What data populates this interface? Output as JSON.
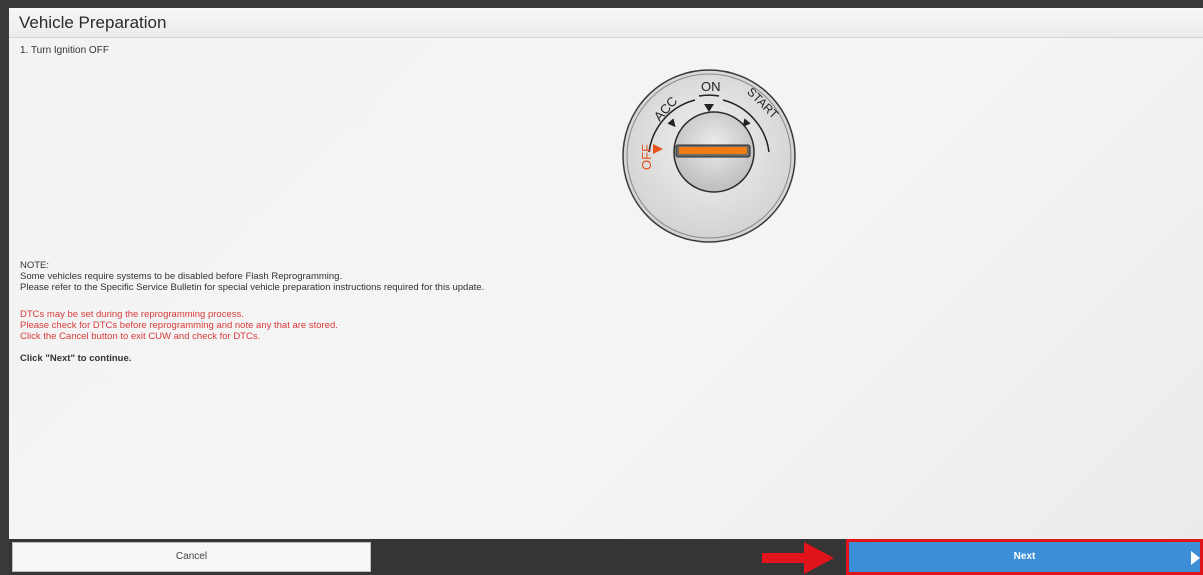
{
  "header": {
    "title": "Vehicle Preparation"
  },
  "step": "1. Turn Ignition OFF",
  "ignition": {
    "labels": {
      "off": "OFF",
      "acc": "ACC",
      "on": "ON",
      "start": "START"
    },
    "colors": {
      "off": "#e8531c",
      "slot": "#f07c12",
      "label": "#222222"
    }
  },
  "notes": {
    "heading": "NOTE:",
    "lines": [
      "Some vehicles require systems to be disabled before Flash Reprogramming.",
      "Please refer to the Specific Service Bulletin for special vehicle preparation instructions required for this update."
    ],
    "warnings": [
      "DTCs may be set during the reprogramming process.",
      "Please check for DTCs before reprogramming and note any that are stored.",
      "Click the Cancel button to exit CUW and check for DTCs."
    ],
    "continue": "Click \"Next\" to continue."
  },
  "footer": {
    "cancel_label": "Cancel",
    "next_label": "Next",
    "accent": "#3c8fd6",
    "highlight": "#e0141a"
  }
}
